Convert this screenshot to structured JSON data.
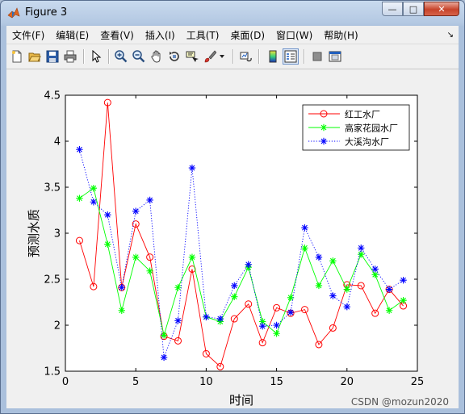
{
  "window": {
    "title": "Figure 3"
  },
  "menu": [
    {
      "label": "文件(F)"
    },
    {
      "label": "编辑(E)"
    },
    {
      "label": "查看(V)"
    },
    {
      "label": "插入(I)"
    },
    {
      "label": "工具(T)"
    },
    {
      "label": "桌面(D)"
    },
    {
      "label": "窗口(W)"
    },
    {
      "label": "帮助(H)"
    }
  ],
  "colors": {
    "series1": "#ff0000",
    "series2": "#00ff00",
    "series3": "#0000ff",
    "accent": "#1f5fbf"
  },
  "chart_data": {
    "type": "line",
    "xlabel": "时间",
    "ylabel": "预测水质",
    "xlim": [
      0,
      25
    ],
    "ylim": [
      1.5,
      4.5
    ],
    "xticks": [
      0,
      5,
      10,
      15,
      20,
      25
    ],
    "yticks": [
      1.5,
      2,
      2.5,
      3,
      3.5,
      4,
      4.5
    ],
    "grid": false,
    "legend_position": "top-right",
    "x": [
      1,
      2,
      3,
      4,
      5,
      6,
      7,
      8,
      9,
      10,
      11,
      12,
      13,
      14,
      15,
      16,
      17,
      18,
      19,
      20,
      21,
      22,
      23,
      24
    ],
    "series": [
      {
        "name": "红工水厂",
        "style": "solid-circle",
        "color": "#ff0000",
        "values": [
          2.92,
          2.42,
          4.42,
          2.41,
          3.1,
          2.74,
          1.88,
          1.83,
          2.61,
          1.69,
          1.55,
          2.07,
          2.23,
          1.81,
          2.19,
          2.13,
          2.17,
          1.79,
          1.97,
          2.44,
          2.43,
          2.13,
          2.39,
          2.21
        ]
      },
      {
        "name": "高家花园水厂",
        "style": "solid-star",
        "color": "#00ff00",
        "values": [
          3.38,
          3.49,
          2.88,
          2.16,
          2.74,
          2.59,
          1.89,
          2.41,
          2.74,
          2.09,
          2.04,
          2.31,
          2.63,
          2.04,
          1.91,
          2.3,
          2.84,
          2.43,
          2.7,
          2.39,
          2.77,
          2.55,
          2.16,
          2.27
        ]
      },
      {
        "name": "大溪沟水厂",
        "style": "dotted-star",
        "color": "#0000ff",
        "values": [
          3.91,
          3.34,
          3.2,
          2.41,
          3.24,
          3.36,
          1.65,
          2.05,
          3.71,
          2.09,
          2.07,
          2.43,
          2.66,
          1.99,
          2.0,
          2.14,
          3.06,
          2.74,
          2.32,
          2.2,
          2.84,
          2.61,
          2.39,
          2.49
        ]
      }
    ]
  },
  "watermark": "CSDN @mozun2020"
}
